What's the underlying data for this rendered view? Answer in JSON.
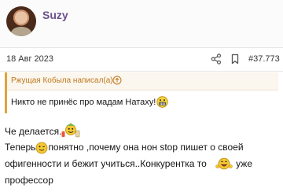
{
  "user": {
    "name": "Suzy",
    "avatar_icon": "user-avatar"
  },
  "meta": {
    "date": "18 Авг 2023",
    "share_icon": "share-icon",
    "bookmark_icon": "bookmark-icon",
    "post_number": "#37.773"
  },
  "quote": {
    "author": "Ржущая Кобыла написал(а):",
    "text": "Никто не принёс про мадам Натаху!",
    "smiley": "grin-smiley-icon"
  },
  "message": {
    "line1": "Че делается.",
    "line2_a": "Теперь",
    "line2_b": "понятно ,почему она нон stop пишет о своей",
    "line3_a": "офигенности и бежит учиться..Конкурентка то",
    "line3_b": "уже",
    "line4": "профессор"
  },
  "colors": {
    "username": "#6b4f8c",
    "quote_accent": "#e0a43a",
    "quote_author": "#c0781d"
  }
}
